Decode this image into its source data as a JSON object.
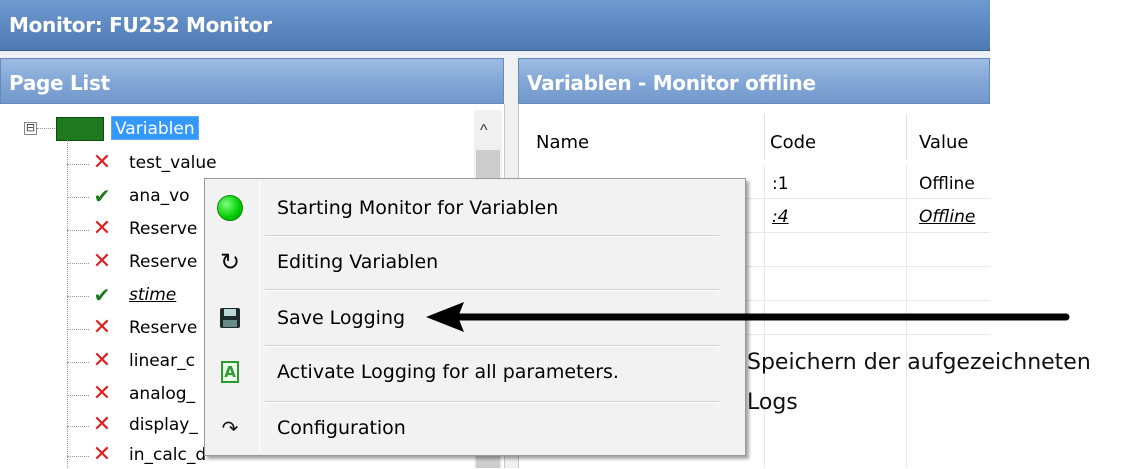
{
  "window": {
    "title": "Monitor: FU252 Monitor"
  },
  "page_list": {
    "header": "Page List",
    "root": {
      "label": "Variablen",
      "expander": "⊟",
      "color": "#1f7a1f"
    },
    "items": [
      {
        "label": "test_value",
        "status": "error",
        "icon": "x-icon"
      },
      {
        "label": "ana_vo",
        "status": "ok",
        "icon": "check-icon"
      },
      {
        "label": "Reserve",
        "status": "error",
        "icon": "x-icon"
      },
      {
        "label": "Reserve",
        "status": "error",
        "icon": "x-icon"
      },
      {
        "label": "stime",
        "status": "ok",
        "icon": "check-icon",
        "italic": true
      },
      {
        "label": "Reserve",
        "status": "error",
        "icon": "x-icon"
      },
      {
        "label": "linear_c",
        "status": "error",
        "icon": "x-icon"
      },
      {
        "label": "analog_",
        "status": "error",
        "icon": "x-icon"
      },
      {
        "label": "display_",
        "status": "error",
        "icon": "x-icon"
      },
      {
        "label": "in_calc_d",
        "status": "error",
        "icon": "x-icon"
      }
    ]
  },
  "variables_panel": {
    "header": "Variablen - Monitor offline",
    "columns": [
      "Name",
      "Code",
      "Value"
    ],
    "rows": [
      {
        "code": ":1",
        "value": "Offline"
      },
      {
        "code": ":4",
        "value": "Offline",
        "italic": true
      }
    ]
  },
  "context_menu": {
    "items": [
      {
        "label": "Starting Monitor for Variablen",
        "icon": "green-circle-icon"
      },
      {
        "label": "Editing Variablen",
        "icon": "redo-arrow-icon"
      },
      {
        "label": "Save Logging",
        "icon": "floppy-disk-icon"
      },
      {
        "label": "Activate Logging for all parameters.",
        "icon": "logging-a-icon"
      },
      {
        "label": "Configuration",
        "icon": "configuration-icon"
      }
    ]
  },
  "annotation": {
    "line1": "Speichern der aufgezeichneten",
    "line2": "Logs"
  },
  "colors": {
    "title_blue": "#5c87c0",
    "header_blue": "#83a7d6",
    "selection": "#3399ff",
    "error_red": "#e02020",
    "ok_green": "#1c7a1c"
  }
}
